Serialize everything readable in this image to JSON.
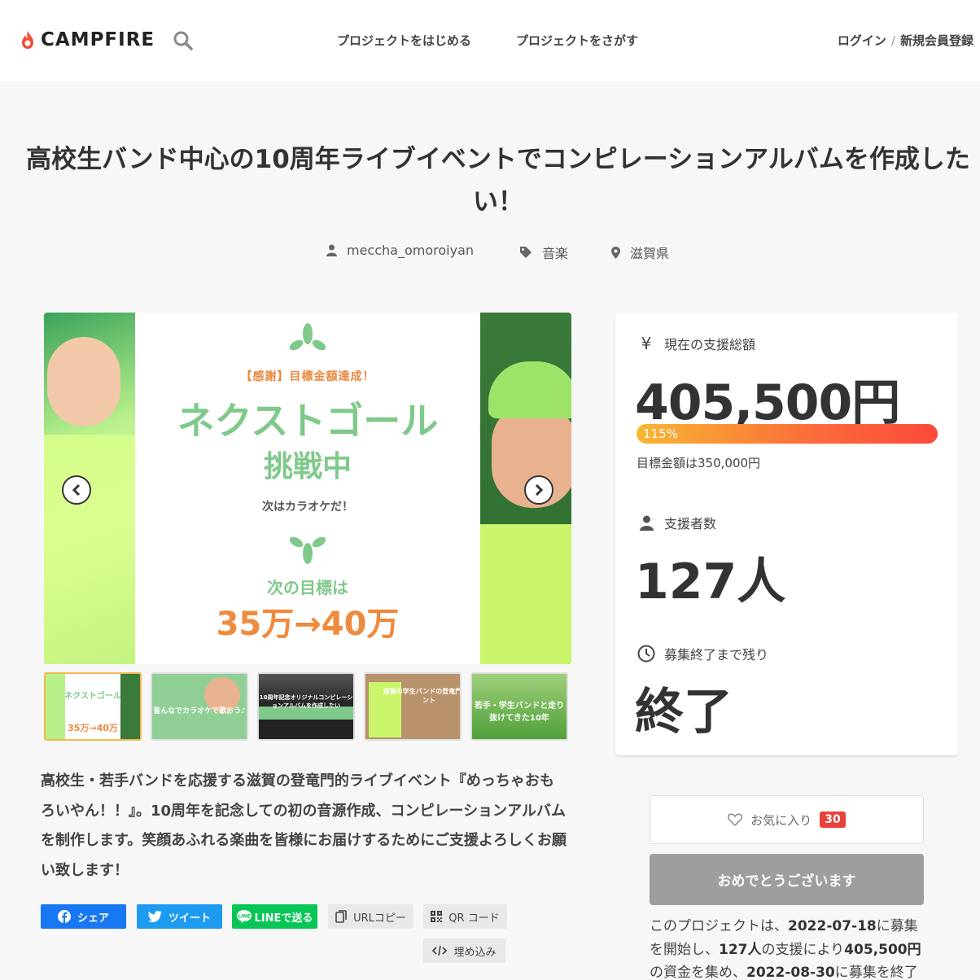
{
  "header": {
    "brand": "CAMPFIRE",
    "nav": {
      "start": "プロジェクトをはじめる",
      "find": "プロジェクトをさがす"
    },
    "login": "ログイン",
    "separator": "/",
    "signup": "新規会員登録"
  },
  "project": {
    "title": "高校生バンド中心の10周年ライブイベントでコンピレーションアルバムを作成したい！",
    "owner": "meccha_omoroiyan",
    "category": "音楽",
    "location": "滋賀県"
  },
  "poster": {
    "thanks": "【感謝】目標金額達成！",
    "next_goal": "ネクストゴール",
    "challenge": "挑戦中",
    "karaoke": "次はカラオケだ！",
    "next_target": "次の目標は",
    "goal_amount": "35万→40万"
  },
  "thumbnails": [
    {
      "caption_top": "ネクストゴール",
      "caption_bottom": "35万→40万"
    },
    {
      "caption": "皆んなでカラオケで歌おう♪"
    },
    {
      "caption": "10周年記念オリジナルコンピレーションアルバムを作成したい"
    },
    {
      "caption": "滋賀の学生バンドの登竜門イベント"
    },
    {
      "caption": "若手・学生バンドと走り抜けてきた10年"
    }
  ],
  "description": "高校生・若手バンドを応援する滋賀の登竜門的ライブイベント『めっちゃおもろいやん！！』。10周年を記念しての初の音源作成、コンピレーションアルバムを制作します。笑顔あふれる楽曲を皆様にお届けするためにご支援よろしくお願い致します！",
  "share": {
    "facebook": "シェア",
    "twitter": "ツイート",
    "line": "LINEで送る",
    "url_copy": "URLコピー",
    "qr": "QR コード",
    "embed": "埋め込み"
  },
  "stats": {
    "total_label": "現在の支援総額",
    "total_value": "405,500円",
    "progress_label": "115%",
    "progress_percent": 115,
    "goal_text": "目標金額は350,000円",
    "backers_label": "支援者数",
    "backers_value": "127人",
    "remaining_label": "募集終了まで残り",
    "remaining_value": "終了"
  },
  "favorite": {
    "label": "お気に入り",
    "count": "30"
  },
  "done_button": "おめでとうございます",
  "summary": {
    "part1": "このプロジェクトは、",
    "start_date": "2022-07-18",
    "part2": "に募集を開始し、",
    "backers": "127人",
    "part3": "の支援により",
    "amount": "405,500円",
    "part4": "の資金を集め、",
    "end_date": "2022-08-30",
    "part5": "に募集を終了"
  },
  "colors": {
    "accent_orange": "#fc6a3a",
    "facebook": "#1877f2",
    "twitter": "#1d9bf0",
    "line": "#06c755",
    "badge_red": "#e8403a",
    "poster_green": "#7fc98a",
    "poster_orange": "#f08a3c"
  }
}
